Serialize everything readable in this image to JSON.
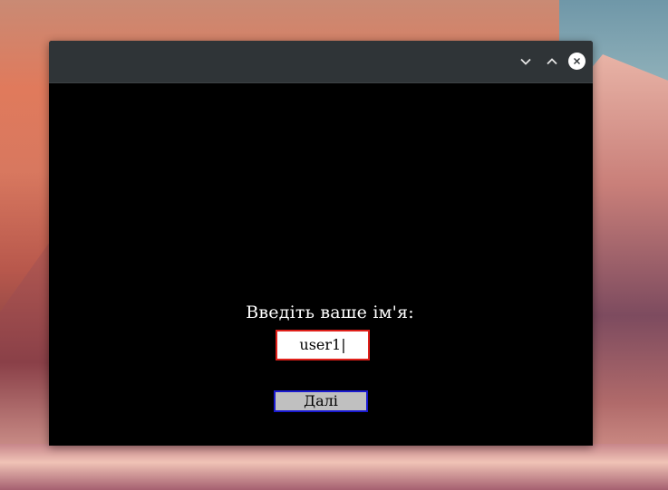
{
  "window": {
    "controls": {
      "minimize_icon": "chevron-down-icon",
      "maximize_icon": "chevron-up-icon",
      "close_icon": "close-icon"
    }
  },
  "form": {
    "prompt": "Введіть ваше ім'я:",
    "name_value": "user1|",
    "next_label": "Далі"
  },
  "colors": {
    "input_border": "#e0201a",
    "button_border": "#1a1ad0",
    "button_bg": "#c0c0c0",
    "titlebar": "#2f3437",
    "content_bg": "#000000"
  }
}
